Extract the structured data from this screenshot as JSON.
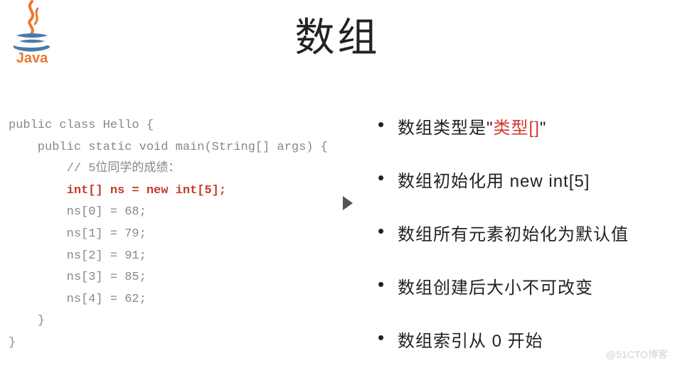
{
  "logo": {
    "brand": "Java"
  },
  "title": "数组",
  "code": {
    "line1": "public class Hello {",
    "line2": "    public static void main(String[] args) {",
    "line3": "        // 5位同学的成绩：",
    "line4_hl": "        int[] ns = new int[5];",
    "line5": "        ns[0] = 68;",
    "line6": "        ns[1] = 79;",
    "line7": "        ns[2] = 91;",
    "line8": "        ns[3] = 85;",
    "line9": "        ns[4] = 62;",
    "line10": "    }",
    "line11": "}"
  },
  "bullets": {
    "b1": {
      "pre": "数组类型是\"",
      "red": "类型[]",
      "post": "\""
    },
    "b2": "数组初始化用 new int[5]",
    "b3": "数组所有元素初始化为默认值",
    "b4": "数组创建后大小不可改变",
    "b5": "数组索引从 0 开始"
  },
  "watermark": "@51CTO博客"
}
